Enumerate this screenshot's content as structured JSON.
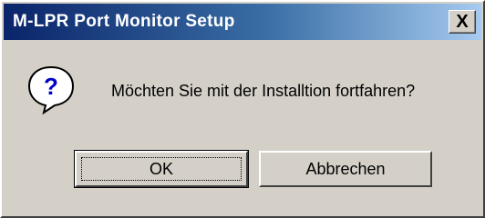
{
  "window": {
    "title": "M-LPR Port Monitor Setup",
    "close_glyph": "X"
  },
  "dialog": {
    "icon": "question-icon",
    "message": "Möchten Sie mit der Installtion fortfahren?"
  },
  "buttons": {
    "ok_label": "OK",
    "cancel_label": "Abbrechen"
  },
  "colors": {
    "title_bar_start": "#0a246a",
    "title_bar_end": "#a6caf0",
    "face": "#d4d0c8"
  }
}
